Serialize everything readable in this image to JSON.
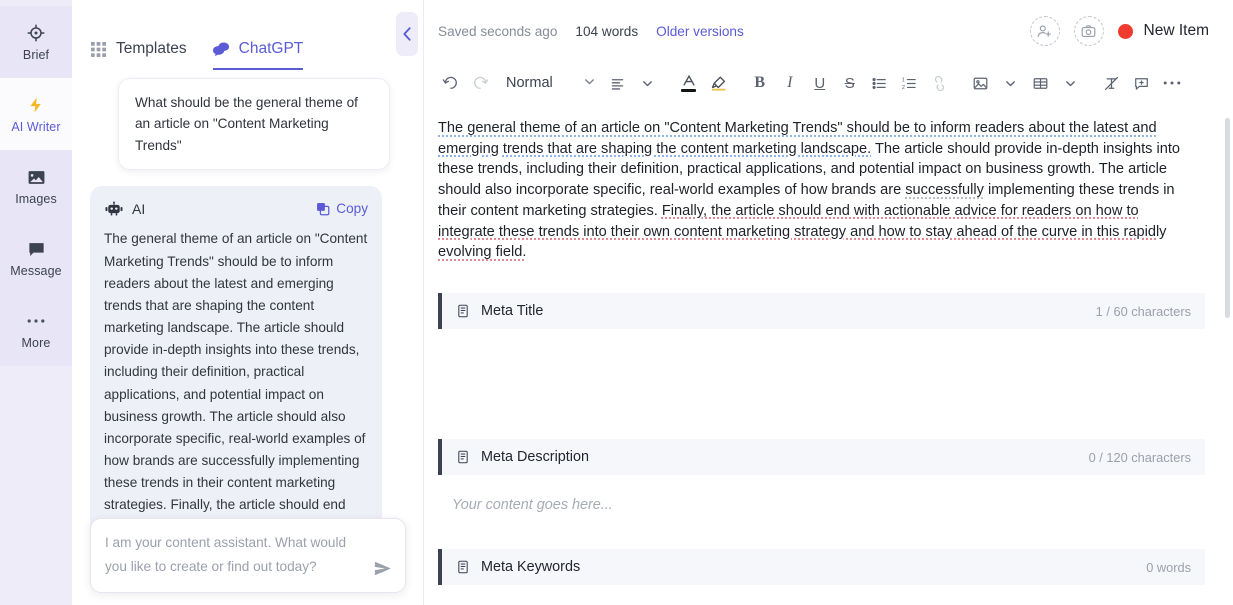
{
  "rail": {
    "items": [
      {
        "label": "Brief",
        "icon": "target-icon",
        "selected": false,
        "bg": "active"
      },
      {
        "label": "AI Writer",
        "icon": "bolt-icon",
        "selected": true,
        "bg": "white"
      },
      {
        "label": "Images",
        "icon": "image-icon",
        "selected": false,
        "bg": "active"
      },
      {
        "label": "Message",
        "icon": "chat-bubble-icon",
        "selected": false,
        "bg": "active"
      },
      {
        "label": "More",
        "icon": "ellipsis-icon",
        "selected": false,
        "bg": "active"
      }
    ]
  },
  "chat": {
    "tabs": [
      {
        "label": "Templates",
        "icon": "grid-icon",
        "active": false
      },
      {
        "label": "ChatGPT",
        "icon": "chat-dual-bubble-icon",
        "active": true
      }
    ],
    "collapse_icon": "chevron-left-icon",
    "user_message": "What should be the general theme of an article on \"Content Marketing Trends\"",
    "ai_name": "AI",
    "ai_copy_label": "Copy",
    "ai_message": "The general theme of an article on \"Content Marketing Trends\" should be to inform readers about the latest and emerging trends that are shaping the content marketing landscape. The article should provide in-depth insights into these trends, including their definition, practical applications, and potential impact on business growth. The article should also incorporate specific, real-world examples of how brands are successfully implementing these trends in their content marketing strategies. Finally, the article should end with actionable advice for readers on how to integrate these trends into",
    "composer_placeholder": "I am your content assistant. What would you like to create or find out today?",
    "composer_value": "",
    "send_icon": "send-paper-plane-icon"
  },
  "header": {
    "saved_status": "Saved seconds ago",
    "word_count": "104 words",
    "older_versions": "Older versions",
    "add_person_icon": "add-person-icon",
    "add_image_icon": "add-image-icon",
    "new_item_label": "New Item",
    "new_item_dot_color": "#f03c2e"
  },
  "toolbar": {
    "undo_icon": "undo-icon",
    "redo_icon": "redo-icon",
    "style_label": "Normal",
    "style_caret_icon": "chevron-down-icon",
    "align_icon": "align-left-icon",
    "align_caret_icon": "chevron-down-icon",
    "text_color_icon": "text-color-a-icon",
    "highlight_icon": "highlighter-icon",
    "bold_label": "B",
    "italic_label": "I",
    "underline_label": "U",
    "strike_label": "S",
    "bullet_list_icon": "bullet-list-icon",
    "numbered_list_icon": "numbered-list-icon",
    "link_icon": "link-icon",
    "image_icon": "insert-image-icon",
    "image_caret_icon": "chevron-down-icon",
    "table_icon": "insert-table-icon",
    "table_caret_icon": "chevron-down-icon",
    "clear_format_icon": "clear-formatting-icon",
    "comment_icon": "add-comment-icon",
    "more_icon": "ellipsis-icon"
  },
  "document": {
    "paragraph_segments": [
      {
        "text": "The general theme of an article on \"Content Marketing Trends\" should be to inform readers about the latest and emerging trends that are shaping the content marketing landscape.",
        "underline": "blue"
      },
      {
        "text": " The article should provide in-depth insights into these trends, including their definition, practical applications, and potential impact on business growth. The article should also incorporate specific, real-world examples of how brands are ",
        "underline": "none"
      },
      {
        "text": "successfully",
        "underline": "gray"
      },
      {
        "text": " implementing these trends in their content marketing strategies. ",
        "underline": "none"
      },
      {
        "text": "Finally, the article should end with actionable advice for readers on how to integrate these trends into their own content marketing strategy and how to stay ahead of the curve in this rapidly evolving field.",
        "underline": "red"
      }
    ]
  },
  "meta_sections": [
    {
      "icon": "document-icon",
      "label": "Meta Title",
      "count": "1 / 60 characters",
      "body": "",
      "placeholder": ""
    },
    {
      "icon": "document-icon",
      "label": "Meta Description",
      "count": "0 / 120 characters",
      "body": "Your content goes here...",
      "placeholder": "Your content goes here..."
    },
    {
      "icon": "document-icon",
      "label": "Meta Keywords",
      "count": "0 words",
      "body": "",
      "placeholder": ""
    }
  ]
}
